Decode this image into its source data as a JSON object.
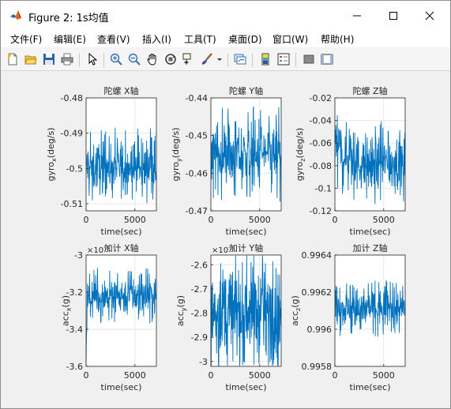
{
  "window": {
    "title": "Figure 2: 1s均值",
    "icon": "matlab-logo-icon",
    "controls": [
      "minimize-icon",
      "maximize-icon",
      "close-icon"
    ]
  },
  "menu": {
    "items": [
      "文件(F)",
      "编辑(E)",
      "查看(V)",
      "插入(I)",
      "工具(T)",
      "桌面(D)",
      "窗口(W)",
      "帮助(H)"
    ]
  },
  "toolbar": {
    "buttons": [
      "new-figure-icon",
      "open-file-icon",
      "save-icon",
      "print-icon",
      "pointer-icon",
      "zoom-in-icon",
      "zoom-out-icon",
      "pan-hand-icon",
      "rotate-3d-icon",
      "data-cursor-icon",
      "brush-icon",
      "brush-dropdown-icon",
      "link-plot-icon",
      "colorbar-icon",
      "legend-icon",
      "hide-plot-tools-icon",
      "show-plot-tools-icon"
    ]
  },
  "colors": {
    "series": "#0072bd",
    "grid": "#e6e6e6",
    "axis": "#262626"
  },
  "chart_data": [
    {
      "type": "line",
      "title": "陀螺 X轴",
      "xlabel": "time(sec)",
      "ylabel_base": "gyro",
      "ylabel_sub": "x",
      "ylabel_tail": "(deg/s)",
      "xlim": [
        0,
        7200
      ],
      "ylim": [
        -0.512,
        -0.48
      ],
      "xticks": [
        0,
        5000
      ],
      "xtick_labels": [
        "0",
        "5000"
      ],
      "yticks": [
        -0.48,
        -0.49,
        -0.5,
        -0.51
      ],
      "ytick_labels": [
        "-0.48",
        "-0.49",
        "-0.5",
        "-0.51"
      ],
      "exponent": "",
      "grid": true,
      "noise": {
        "mean": -0.4995,
        "amplitude": 0.0065,
        "start_mean": -0.4995,
        "start_len": 0
      }
    },
    {
      "type": "line",
      "title": "陀螺 Y轴",
      "xlabel": "time(sec)",
      "ylabel_base": "gyro",
      "ylabel_sub": "y",
      "ylabel_tail": "(deg/s)",
      "xlim": [
        0,
        7200
      ],
      "ylim": [
        -0.47,
        -0.44
      ],
      "xticks": [
        0,
        5000
      ],
      "xtick_labels": [
        "0",
        "5000"
      ],
      "yticks": [
        -0.44,
        -0.45,
        -0.46,
        -0.47
      ],
      "ytick_labels": [
        "-0.44",
        "-0.45",
        "-0.46",
        "-0.47"
      ],
      "exponent": "",
      "grid": true,
      "noise": {
        "mean": -0.455,
        "amplitude": 0.0075,
        "start_mean": -0.455,
        "start_len": 0
      }
    },
    {
      "type": "line",
      "title": "陀螺 Z轴",
      "xlabel": "time(sec)",
      "ylabel_base": "gyro",
      "ylabel_sub": "z",
      "ylabel_tail": "(deg/s)",
      "xlim": [
        0,
        7200
      ],
      "ylim": [
        -0.12,
        -0.02
      ],
      "xticks": [
        0,
        5000
      ],
      "xtick_labels": [
        "0",
        "5000"
      ],
      "yticks": [
        -0.02,
        -0.04,
        -0.06,
        -0.08,
        -0.1,
        -0.12
      ],
      "ytick_labels": [
        "-0.02",
        "-0.04",
        "-0.06",
        "-0.08",
        "-0.1",
        "-0.12"
      ],
      "exponent": "",
      "grid": true,
      "noise": {
        "mean": -0.078,
        "amplitude": 0.022,
        "start_mean": -0.06,
        "start_len": 0.25
      }
    },
    {
      "type": "line",
      "title": "加计 X轴",
      "xlabel": "time(sec)",
      "ylabel_base": "acc",
      "ylabel_sub": "x",
      "ylabel_tail": "(g)",
      "xlim": [
        0,
        7200
      ],
      "ylim": [
        -3.6,
        -3.0
      ],
      "xticks": [
        0,
        5000
      ],
      "xtick_labels": [
        "0",
        "5000"
      ],
      "yticks": [
        -3.0,
        -3.2,
        -3.4,
        -3.6
      ],
      "ytick_labels": [
        "-3",
        "-3.2",
        "-3.4",
        "-3.6"
      ],
      "exponent": "×10",
      "exponent_power": "-3",
      "grid": true,
      "noise": {
        "mean": -3.22,
        "amplitude": 0.09,
        "start_mean": -3.5,
        "start_len": 0.02
      }
    },
    {
      "type": "line",
      "title": "加计 Y轴",
      "xlabel": "time(sec)",
      "ylabel_base": "acc",
      "ylabel_sub": "y",
      "ylabel_tail": "(g)",
      "xlim": [
        0,
        7200
      ],
      "ylim": [
        -3.02,
        -2.56
      ],
      "xticks": [
        0,
        5000
      ],
      "xtick_labels": [
        "0",
        "5000"
      ],
      "yticks": [
        -2.6,
        -2.7,
        -2.8,
        -2.9,
        -3.0
      ],
      "ytick_labels": [
        "-2.6",
        "-2.7",
        "-2.8",
        "-2.9",
        "-3"
      ],
      "exponent": "×10",
      "exponent_power": "-3",
      "grid": true,
      "noise": {
        "mean": -2.8,
        "amplitude": 0.17,
        "start_mean": -2.8,
        "start_len": 0
      }
    },
    {
      "type": "line",
      "title": "加计 Z轴",
      "xlabel": "time(sec)",
      "ylabel_base": "acc",
      "ylabel_sub": "z",
      "ylabel_tail": "(g)",
      "xlim": [
        0,
        7200
      ],
      "ylim": [
        0.9958,
        0.9964
      ],
      "xticks": [
        0,
        5000
      ],
      "xtick_labels": [
        "0",
        "5000"
      ],
      "yticks": [
        0.9964,
        0.9962,
        0.996,
        0.9958
      ],
      "ytick_labels": [
        "0.9964",
        "0.9962",
        "0.996",
        "0.9958"
      ],
      "exponent": "",
      "grid": true,
      "noise": {
        "mean": 0.99611,
        "amplitude": 9e-05,
        "start_mean": 0.99611,
        "start_len": 0
      }
    }
  ]
}
